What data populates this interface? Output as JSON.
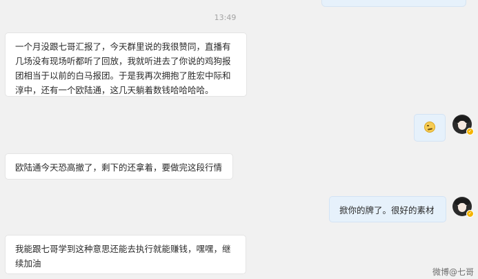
{
  "timestamp": "13:49",
  "messages": [
    {
      "side": "left",
      "text": "一个月没跟七哥汇报了，今天群里说的我很赞同，直播有几场没有现场听都听了回放，我就听进去了你说的鸡狗报团相当于以前的白马报团。于是我再次拥抱了胜宏中际和淳中，还有一个欧陆通，这几天躺着数钱哈哈哈哈。"
    },
    {
      "side": "right",
      "emoji": "smirk-emoji"
    },
    {
      "side": "left",
      "text": "欧陆通今天恐高撤了，剩下的还拿着，要做完这段行情"
    },
    {
      "side": "right",
      "text": "掀你的牌了。很好的素材"
    },
    {
      "side": "left",
      "text": "我能跟七哥学到这种意思还能去执行就能赚钱，嘿嘿，继续加油"
    }
  ],
  "watermark": "微博@七哥"
}
